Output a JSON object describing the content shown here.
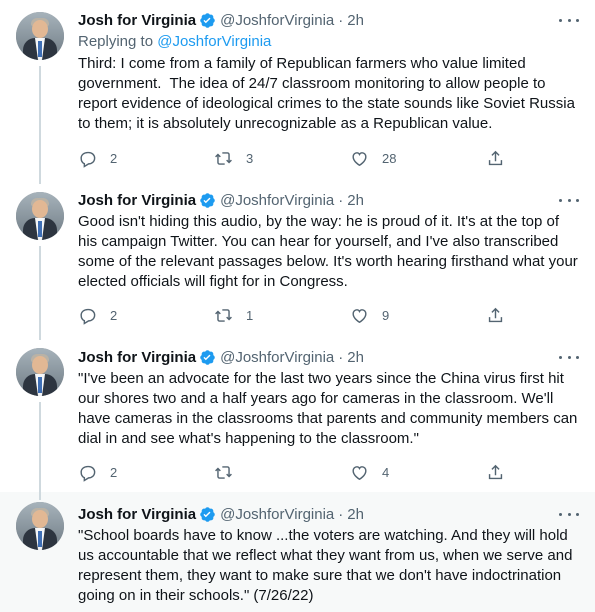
{
  "tweets": [
    {
      "name": "Josh for Virginia",
      "handle": "@JoshforVirginia",
      "time": "2h",
      "replying_prefix": "Replying to ",
      "replying_handle": "@JoshforVirginia",
      "text": "Third: I come from a family of Republican farmers who value limited\ngovernment.  The idea of 24/7 classroom monitoring to allow people to\nreport evidence of ideological crimes to the state sounds like Soviet Russia\nto them; it is absolutely unrecognizable as a Republican value.",
      "replies": "2",
      "retweets": "3",
      "likes": "28"
    },
    {
      "name": "Josh for Virginia",
      "handle": "@JoshforVirginia",
      "time": "2h",
      "text": "Good isn't hiding this audio, by the way: he is proud of it. It's at the top of\nhis campaign Twitter. You can hear for yourself, and I've also transcribed\nsome of the relevant passages below. It's worth hearing firsthand what your\nelected officials will fight for in Congress.",
      "replies": "2",
      "retweets": "1",
      "likes": "9"
    },
    {
      "name": "Josh for Virginia",
      "handle": "@JoshforVirginia",
      "time": "2h",
      "text": "\"I've been an advocate for the last two years since the China virus first hit\nour shores two and a half years ago for cameras in the classroom. We'll\nhave cameras in the classrooms that parents and community members can\ndial in and see what's happening to the classroom.\"",
      "replies": "2",
      "retweets": "",
      "likes": "4"
    },
    {
      "name": "Josh for Virginia",
      "handle": "@JoshforVirginia",
      "time": "2h",
      "text": "\"School boards have to know ...the voters are watching. And they will hold\nus accountable that we reflect what they want from us, when we serve and\nrepresent them, they want to make sure that we don't have indoctrination\ngoing on in their schools.\" (7/26/22)"
    }
  ],
  "separator": "·",
  "colors": {
    "accent": "#1d9bf0",
    "muted": "#536471",
    "text": "#0f1419",
    "thread_line": "#cfd9de",
    "highlight_bg": "#f7f9f9"
  }
}
